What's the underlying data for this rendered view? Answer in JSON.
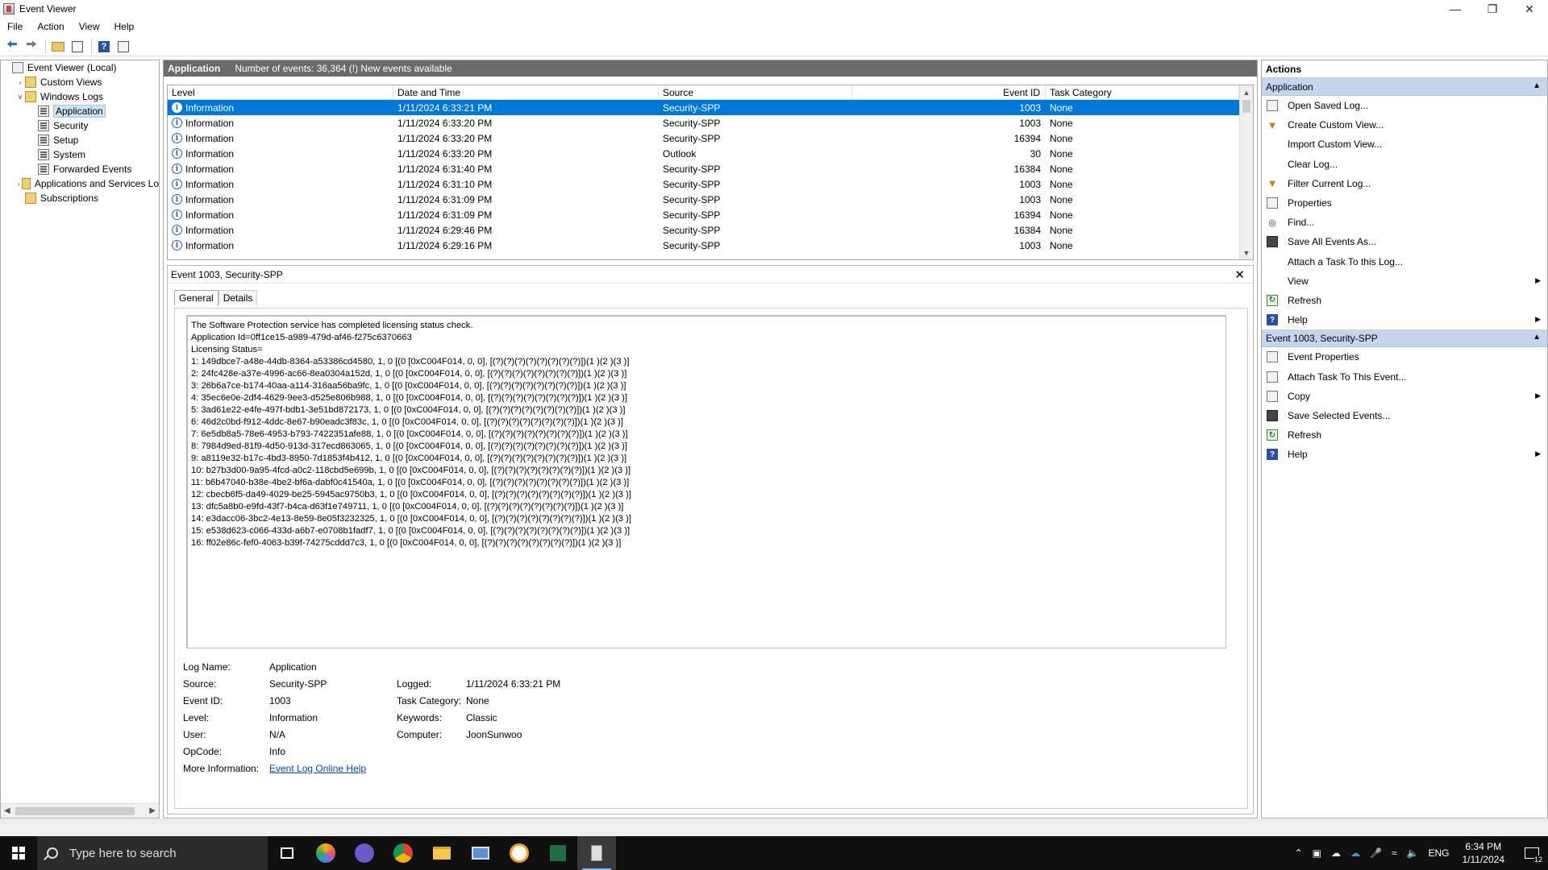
{
  "window": {
    "title": "Event Viewer"
  },
  "menu": [
    "File",
    "Action",
    "View",
    "Help"
  ],
  "tree": {
    "items": [
      {
        "label": "Event Viewer (Local)",
        "level": 0,
        "expander": "",
        "icon": "box"
      },
      {
        "label": "Custom Views",
        "level": 1,
        "expander": ">",
        "icon": "folder"
      },
      {
        "label": "Windows Logs",
        "level": 1,
        "expander": "v",
        "icon": "folder"
      },
      {
        "label": "Application",
        "level": 2,
        "expander": "",
        "icon": "log",
        "selected": true
      },
      {
        "label": "Security",
        "level": 2,
        "expander": "",
        "icon": "log"
      },
      {
        "label": "Setup",
        "level": 2,
        "expander": "",
        "icon": "log"
      },
      {
        "label": "System",
        "level": 2,
        "expander": "",
        "icon": "log"
      },
      {
        "label": "Forwarded Events",
        "level": 2,
        "expander": "",
        "icon": "log"
      },
      {
        "label": "Applications and Services Lo",
        "level": 1,
        "expander": ">",
        "icon": "folder"
      },
      {
        "label": "Subscriptions",
        "level": 1,
        "expander": "",
        "icon": "folder"
      }
    ]
  },
  "log_header": {
    "name": "Application",
    "summary": "Number of events: 36,364 (!) New events available"
  },
  "events_table": {
    "columns": [
      "Level",
      "Date and Time",
      "Source",
      "Event ID",
      "Task Category"
    ],
    "rows": [
      [
        "Information",
        "1/11/2024 6:33:21 PM",
        "Security-SPP",
        "1003",
        "None"
      ],
      [
        "Information",
        "1/11/2024 6:33:20 PM",
        "Security-SPP",
        "1003",
        "None"
      ],
      [
        "Information",
        "1/11/2024 6:33:20 PM",
        "Security-SPP",
        "16394",
        "None"
      ],
      [
        "Information",
        "1/11/2024 6:33:20 PM",
        "Outlook",
        "30",
        "None"
      ],
      [
        "Information",
        "1/11/2024 6:31:40 PM",
        "Security-SPP",
        "16384",
        "None"
      ],
      [
        "Information",
        "1/11/2024 6:31:10 PM",
        "Security-SPP",
        "1003",
        "None"
      ],
      [
        "Information",
        "1/11/2024 6:31:09 PM",
        "Security-SPP",
        "1003",
        "None"
      ],
      [
        "Information",
        "1/11/2024 6:31:09 PM",
        "Security-SPP",
        "16394",
        "None"
      ],
      [
        "Information",
        "1/11/2024 6:29:46 PM",
        "Security-SPP",
        "16384",
        "None"
      ],
      [
        "Information",
        "1/11/2024 6:29:16 PM",
        "Security-SPP",
        "1003",
        "None"
      ]
    ]
  },
  "detail": {
    "title": "Event 1003, Security-SPP",
    "tabs": [
      "General",
      "Details"
    ],
    "description_lines": [
      "The Software Protection service has completed licensing status check.",
      "Application Id=0ff1ce15-a989-479d-af46-f275c6370663",
      "Licensing Status=",
      "1: 149dbce7-a48e-44db-8364-a53386cd4580, 1, 0 [(0 [0xC004F014, 0, 0], [(?)(?)(?)(?)(?)(?)(?)(?)])(1 )(2 )(3 )]",
      "2: 24fc428e-a37e-4996-ac66-8ea0304a152d, 1, 0 [(0 [0xC004F014, 0, 0], [(?)(?)(?)(?)(?)(?)(?)(?)])(1 )(2 )(3 )]",
      "3: 26b6a7ce-b174-40aa-a114-316aa56ba9fc, 1, 0 [(0 [0xC004F014, 0, 0], [(?)(?)(?)(?)(?)(?)(?)(?)])(1 )(2 )(3 )]",
      "4: 35ec6e0e-2df4-4629-9ee3-d525e806b988, 1, 0 [(0 [0xC004F014, 0, 0], [(?)(?)(?)(?)(?)(?)(?)(?)])(1 )(2 )(3 )]",
      "5: 3ad61e22-e4fe-497f-bdb1-3e51bd872173, 1, 0 [(0 [0xC004F014, 0, 0], [(?)(?)(?)(?)(?)(?)(?)(?)])(1 )(2 )(3 )]",
      "6: 46d2c0bd-f912-4ddc-8e67-b90eadc3f83c, 1, 0 [(0 [0xC004F014, 0, 0], [(?)(?)(?)(?)(?)(?)(?)(?)])(1 )(2 )(3 )]",
      "7: 6e5db8a5-78e6-4953-b793-7422351afe88, 1, 0 [(0 [0xC004F014, 0, 0], [(?)(?)(?)(?)(?)(?)(?)(?)])(1 )(2 )(3 )]",
      "8: 7984d9ed-81f9-4d50-913d-317ecd863065, 1, 0 [(0 [0xC004F014, 0, 0], [(?)(?)(?)(?)(?)(?)(?)(?)])(1 )(2 )(3 )]",
      "9: a8119e32-b17c-4bd3-8950-7d1853f4b412, 1, 0 [(0 [0xC004F014, 0, 0], [(?)(?)(?)(?)(?)(?)(?)(?)])(1 )(2 )(3 )]",
      "10: b27b3d00-9a95-4fcd-a0c2-118cbd5e699b, 1, 0 [(0 [0xC004F014, 0, 0], [(?)(?)(?)(?)(?)(?)(?)(?)])(1 )(2 )(3 )]",
      "11: b6b47040-b38e-4be2-bf6a-dabf0c41540a, 1, 0 [(0 [0xC004F014, 0, 0], [(?)(?)(?)(?)(?)(?)(?)(?)])(1 )(2 )(3 )]",
      "12: cbecb6f5-da49-4029-be25-5945ac9750b3, 1, 0 [(0 [0xC004F014, 0, 0], [(?)(?)(?)(?)(?)(?)(?)(?)])(1 )(2 )(3 )]",
      "13: dfc5a8b0-e9fd-43f7-b4ca-d63f1e749711, 1, 0 [(0 [0xC004F014, 0, 0], [(?)(?)(?)(?)(?)(?)(?)(?)])(1 )(2 )(3 )]",
      "14: e3dacc06-3bc2-4e13-8e59-8e05f3232325, 1, 0 [(0 [0xC004F014, 0, 0], [(?)(?)(?)(?)(?)(?)(?)(?)])(1 )(2 )(3 )]",
      "15: e538d623-c066-433d-a6b7-e0708b1fadf7, 1, 0 [(0 [0xC004F014, 0, 0], [(?)(?)(?)(?)(?)(?)(?)(?)])(1 )(2 )(3 )]",
      "16: ff02e86c-fef0-4063-b39f-74275cddd7c3, 1, 0 [(0 [0xC004F014, 0, 0], [(?)(?)(?)(?)(?)(?)(?)(?)])(1 )(2 )(3 )]"
    ],
    "fields": {
      "log_name_label": "Log Name:",
      "log_name": "Application",
      "source_label": "Source:",
      "source": "Security-SPP",
      "logged_label": "Logged:",
      "logged": "1/11/2024 6:33:21 PM",
      "event_id_label": "Event ID:",
      "event_id": "1003",
      "task_category_label": "Task Category:",
      "task_category": "None",
      "level_label": "Level:",
      "level": "Information",
      "keywords_label": "Keywords:",
      "keywords": "Classic",
      "user_label": "User:",
      "user": "N/A",
      "computer_label": "Computer:",
      "computer": "JoonSunwoo",
      "opcode_label": "OpCode:",
      "opcode": "Info",
      "more_info_label": "More Information:",
      "more_info_link": "Event Log Online Help"
    }
  },
  "actions": {
    "title": "Actions",
    "section1": {
      "title": "Application",
      "items": [
        {
          "label": "Open Saved Log...",
          "icon": "box"
        },
        {
          "label": "Create Custom View...",
          "icon": "funnel"
        },
        {
          "label": "Import Custom View...",
          "icon": ""
        },
        {
          "label": "Clear Log...",
          "icon": ""
        },
        {
          "label": "Filter Current Log...",
          "icon": "funnel"
        },
        {
          "label": "Properties",
          "icon": "box"
        },
        {
          "label": "Find...",
          "icon": "find"
        },
        {
          "label": "Save All Events As...",
          "icon": "save"
        },
        {
          "label": "Attach a Task To this Log...",
          "icon": ""
        },
        {
          "label": "View",
          "icon": "",
          "submenu": true
        },
        {
          "label": "Refresh",
          "icon": "green"
        },
        {
          "label": "Help",
          "icon": "help",
          "submenu": true
        }
      ]
    },
    "section2": {
      "title": "Event 1003, Security-SPP",
      "items": [
        {
          "label": "Event Properties",
          "icon": "box"
        },
        {
          "label": "Attach Task To This Event...",
          "icon": "box"
        },
        {
          "label": "Copy",
          "icon": "box",
          "submenu": true
        },
        {
          "label": "Save Selected Events...",
          "icon": "save"
        },
        {
          "label": "Refresh",
          "icon": "green"
        },
        {
          "label": "Help",
          "icon": "help",
          "submenu": true
        }
      ]
    }
  },
  "taskbar": {
    "search_placeholder": "Type here to search",
    "language": "ENG",
    "time": "6:34 PM",
    "date": "1/11/2024",
    "notification_count": "12"
  }
}
